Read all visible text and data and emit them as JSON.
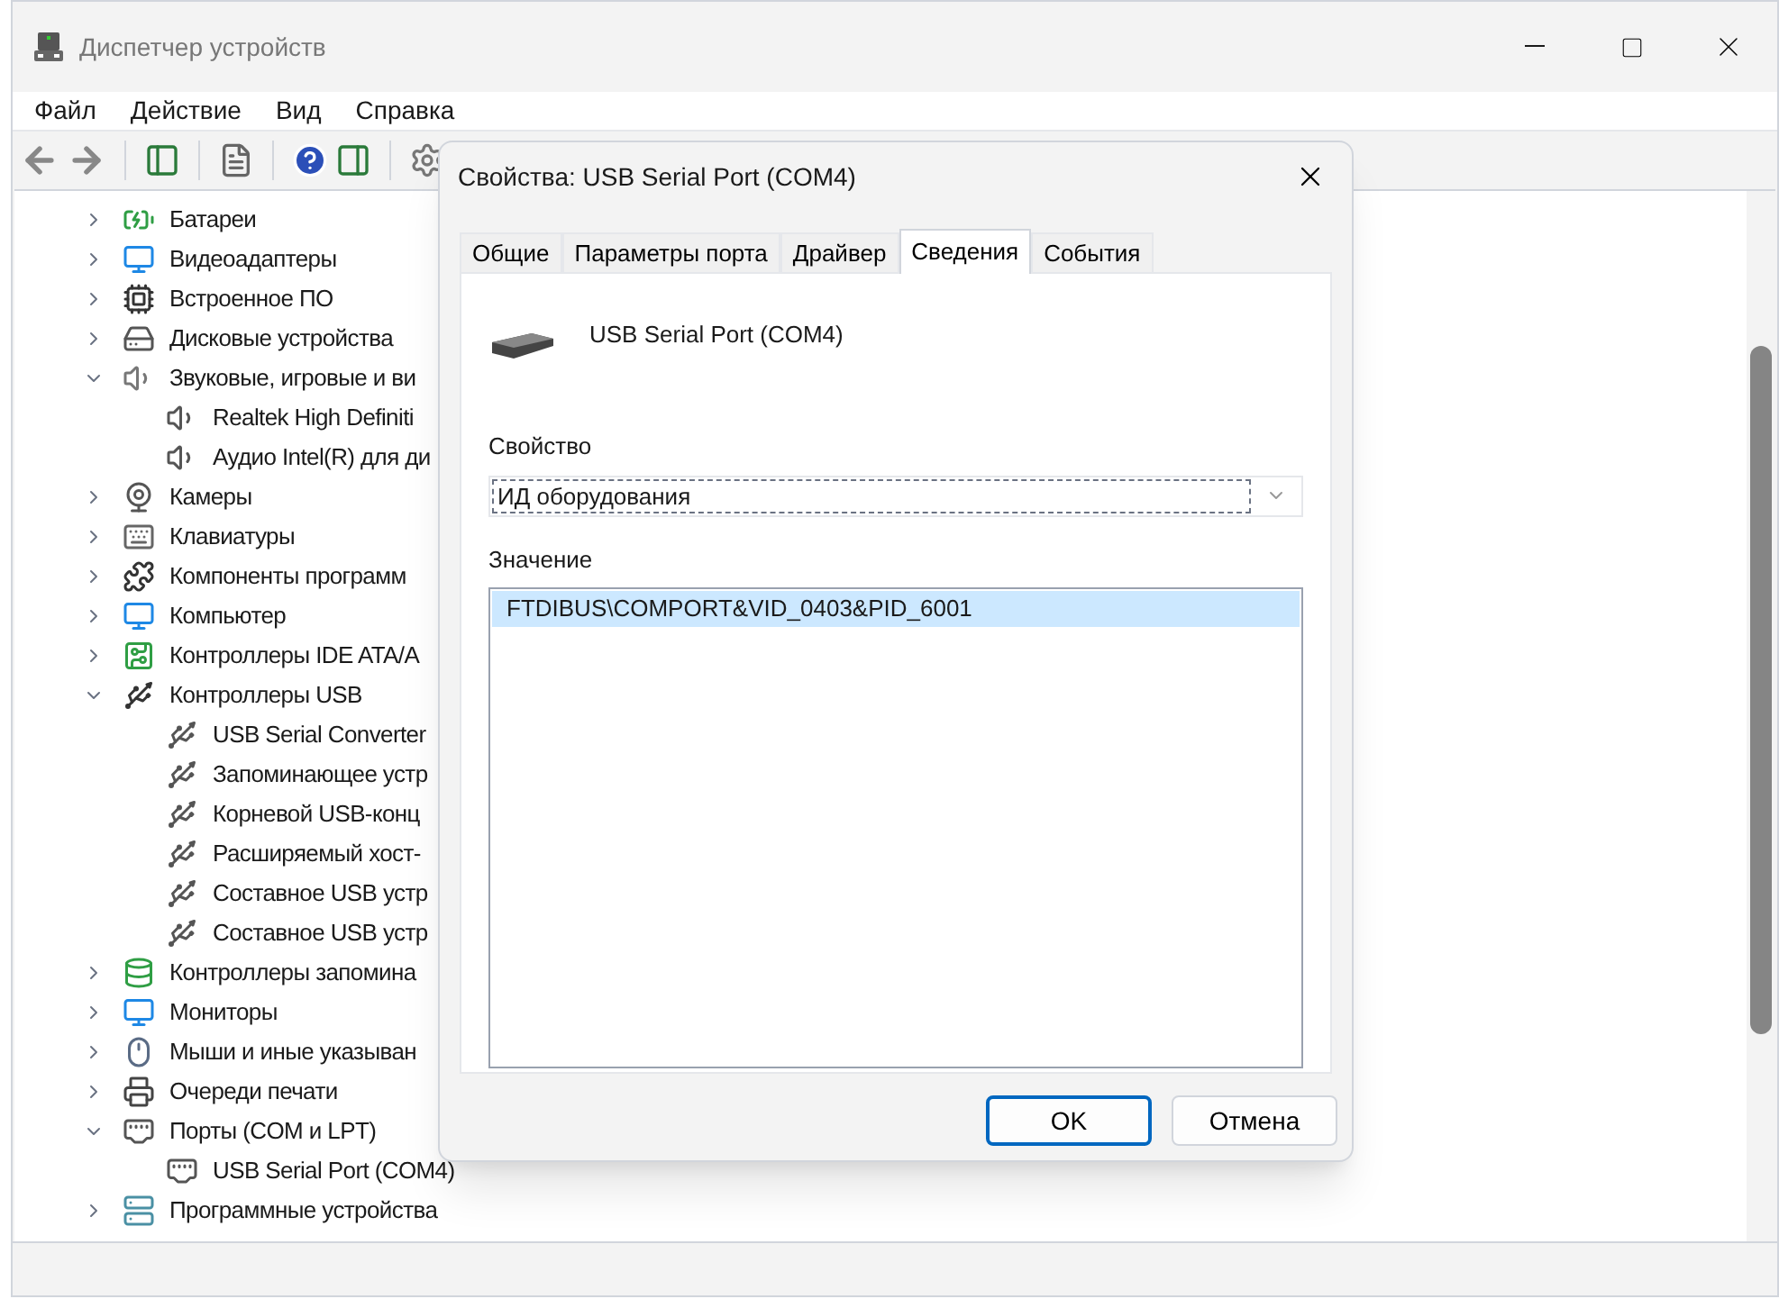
{
  "window": {
    "title": "Диспетчер устройств"
  },
  "menu": [
    "Файл",
    "Действие",
    "Вид",
    "Справка"
  ],
  "tree": [
    {
      "label": "Батареи",
      "expanded": false
    },
    {
      "label": "Видеоадаптеры",
      "expanded": false
    },
    {
      "label": "Встроенное ПО",
      "expanded": false
    },
    {
      "label": "Дисковые устройства",
      "expanded": false
    },
    {
      "label": "Звуковые, игровые и ви",
      "expanded": true,
      "children": [
        {
          "label": "Realtek High Definiti"
        },
        {
          "label": "Аудио Intel(R) для ди"
        }
      ]
    },
    {
      "label": "Камеры",
      "expanded": false
    },
    {
      "label": "Клавиатуры",
      "expanded": false
    },
    {
      "label": "Компоненты программ",
      "expanded": false
    },
    {
      "label": "Компьютер",
      "expanded": false
    },
    {
      "label": "Контроллеры IDE ATA/A",
      "expanded": false
    },
    {
      "label": "Контроллеры USB",
      "expanded": true,
      "children": [
        {
          "label": "USB Serial Converter"
        },
        {
          "label": "Запоминающее устр"
        },
        {
          "label": "Корневой USB-конц"
        },
        {
          "label": "Расширяемый хост-"
        },
        {
          "label": "Составное USB устр"
        },
        {
          "label": "Составное USB устр"
        }
      ]
    },
    {
      "label": "Контроллеры запомина",
      "expanded": false
    },
    {
      "label": "Мониторы",
      "expanded": false
    },
    {
      "label": "Мыши и иные указыван",
      "expanded": false
    },
    {
      "label": "Очереди печати",
      "expanded": false
    },
    {
      "label": "Порты (COM и LPT)",
      "expanded": true,
      "children": [
        {
          "label": "USB Serial Port (COM4)"
        }
      ]
    },
    {
      "label": "Программные устройства",
      "expanded": false
    }
  ],
  "dialog": {
    "title": "Свойства: USB Serial Port (COM4)",
    "tabs": [
      {
        "label": "Общие",
        "selected": false
      },
      {
        "label": "Параметры порта",
        "selected": false
      },
      {
        "label": "Драйвер",
        "selected": false
      },
      {
        "label": "Сведения",
        "selected": true
      },
      {
        "label": "События",
        "selected": false
      }
    ],
    "device_name": "USB Serial Port (COM4)",
    "property_label": "Свойство",
    "property_value": "ИД оборудования",
    "value_label": "Значение",
    "values": [
      {
        "text": "FTDIBUS\\COMPORT&VID_0403&PID_6001",
        "selected": true
      }
    ],
    "buttons": [
      {
        "label": "OK",
        "default": true
      },
      {
        "label": "Отмена",
        "default": false
      }
    ]
  }
}
